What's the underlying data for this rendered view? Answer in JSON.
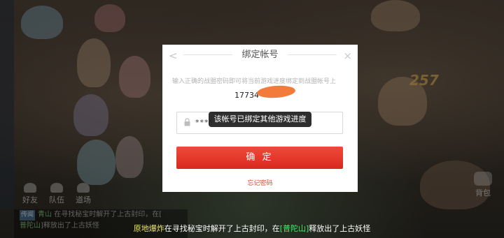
{
  "dialog": {
    "title": "绑定帐号",
    "description": "输入正确的战盟密码即可将当前游戏进度绑定到战盟帐号上",
    "account_partial": "17734",
    "password_masked": "****",
    "confirm_label": "确 定",
    "forgot_label": "忘记密码",
    "back_glyph": "<",
    "close_glyph": "×"
  },
  "toast": {
    "text": "该帐号已绑定其他游戏进度"
  },
  "background": {
    "score": "257",
    "bottom_buttons": [
      "好友",
      "队伍",
      "道场"
    ],
    "right_label": "背包",
    "chat_lines": [
      {
        "tag": "传闻",
        "name": "青山",
        "text": "在寻找秘宝时解开了上古封印，在["
      },
      {
        "tag": "",
        "name": "普陀山",
        "text": "]释放出了上古妖怪"
      }
    ]
  },
  "ticker": {
    "name": "原地爆炸",
    "text1": "在寻找秘宝时解开了上古封印，在",
    "place": "[普陀山]",
    "text2": "释放出了上古妖怪"
  }
}
